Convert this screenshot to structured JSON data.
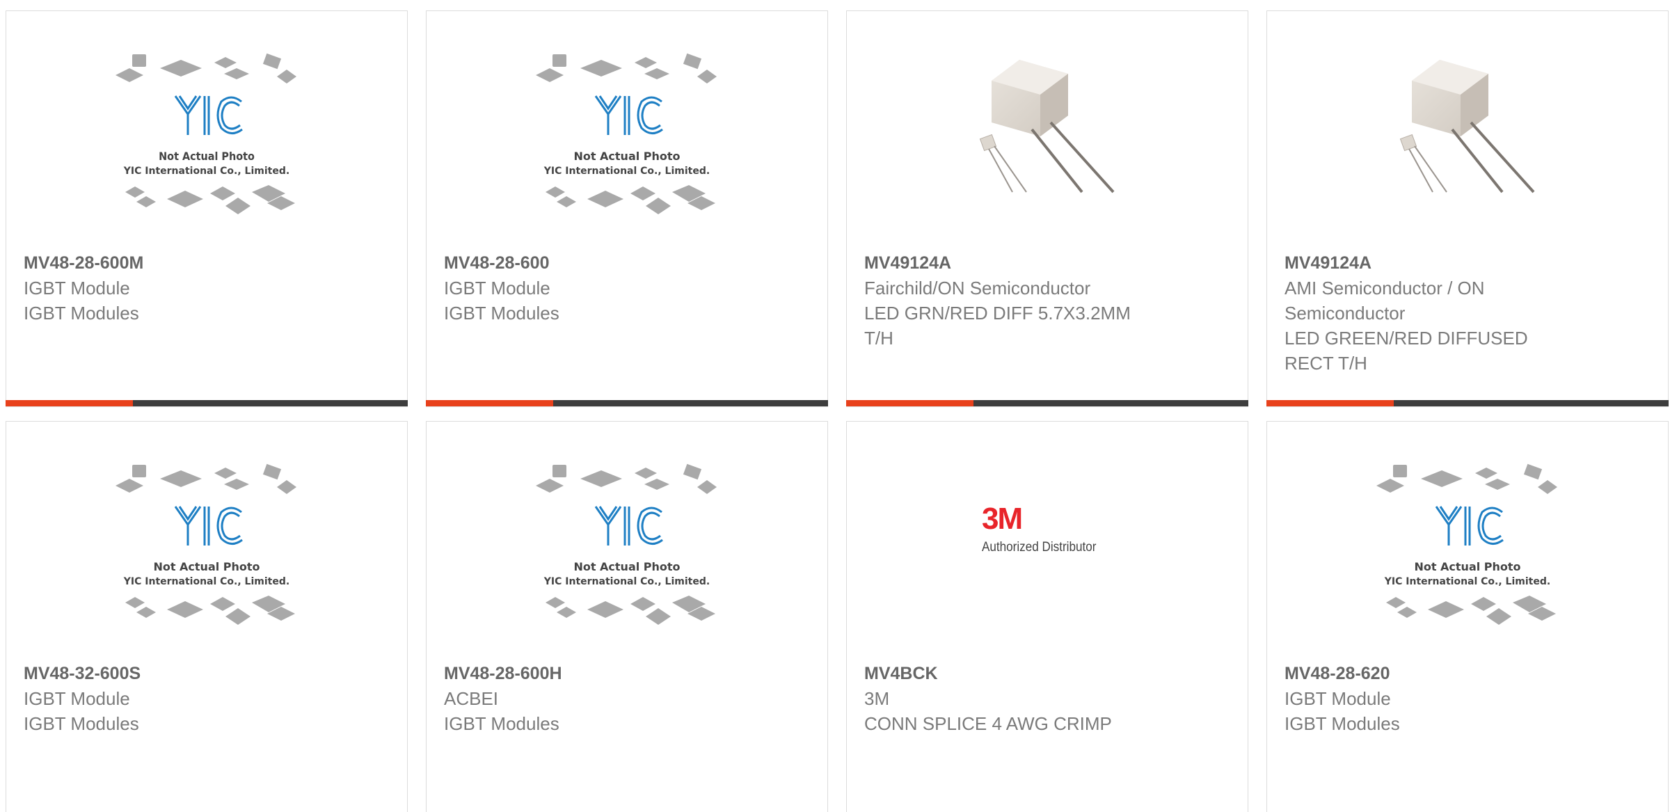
{
  "colors": {
    "accent": "#e8411c",
    "bar_dark": "#3d3d3d",
    "yic_blue": "#1e7fc4"
  },
  "placeholder": {
    "logo": "YIC",
    "line1": "Not Actual Photo",
    "line2": "YIC International Co., Limited."
  },
  "brand_3m": {
    "logo": "3M",
    "tagline": "Authorized Distributor"
  },
  "products": [
    {
      "part": "MV48-28-600M",
      "manufacturer": "IGBT Module",
      "description": "IGBT Modules",
      "image": "yic-placeholder-image"
    },
    {
      "part": "MV48-28-600",
      "manufacturer": "IGBT Module",
      "description": "IGBT Modules",
      "image": "yic-placeholder-image"
    },
    {
      "part": "MV49124A",
      "manufacturer": "Fairchild/ON Semiconductor",
      "description": "LED GRN/RED DIFF 5.7X3.2MM T/H",
      "image": "led-component-photo"
    },
    {
      "part": "MV49124A",
      "manufacturer": "AMI Semiconductor / ON Semiconductor",
      "description": "LED GREEN/RED DIFFUSED RECT T/H",
      "image": "led-component-photo"
    },
    {
      "part": "MV48-32-600S",
      "manufacturer": "IGBT Module",
      "description": "IGBT Modules",
      "image": "yic-placeholder-image"
    },
    {
      "part": "MV48-28-600H",
      "manufacturer": "ACBEI",
      "description": "IGBT Modules",
      "image": "yic-placeholder-image"
    },
    {
      "part": "MV4BCK",
      "manufacturer": "3M",
      "description": "CONN SPLICE 4 AWG CRIMP",
      "image": "3m-logo-image"
    },
    {
      "part": "MV48-28-620",
      "manufacturer": "IGBT Module",
      "description": "IGBT Modules",
      "image": "yic-placeholder-image"
    }
  ]
}
